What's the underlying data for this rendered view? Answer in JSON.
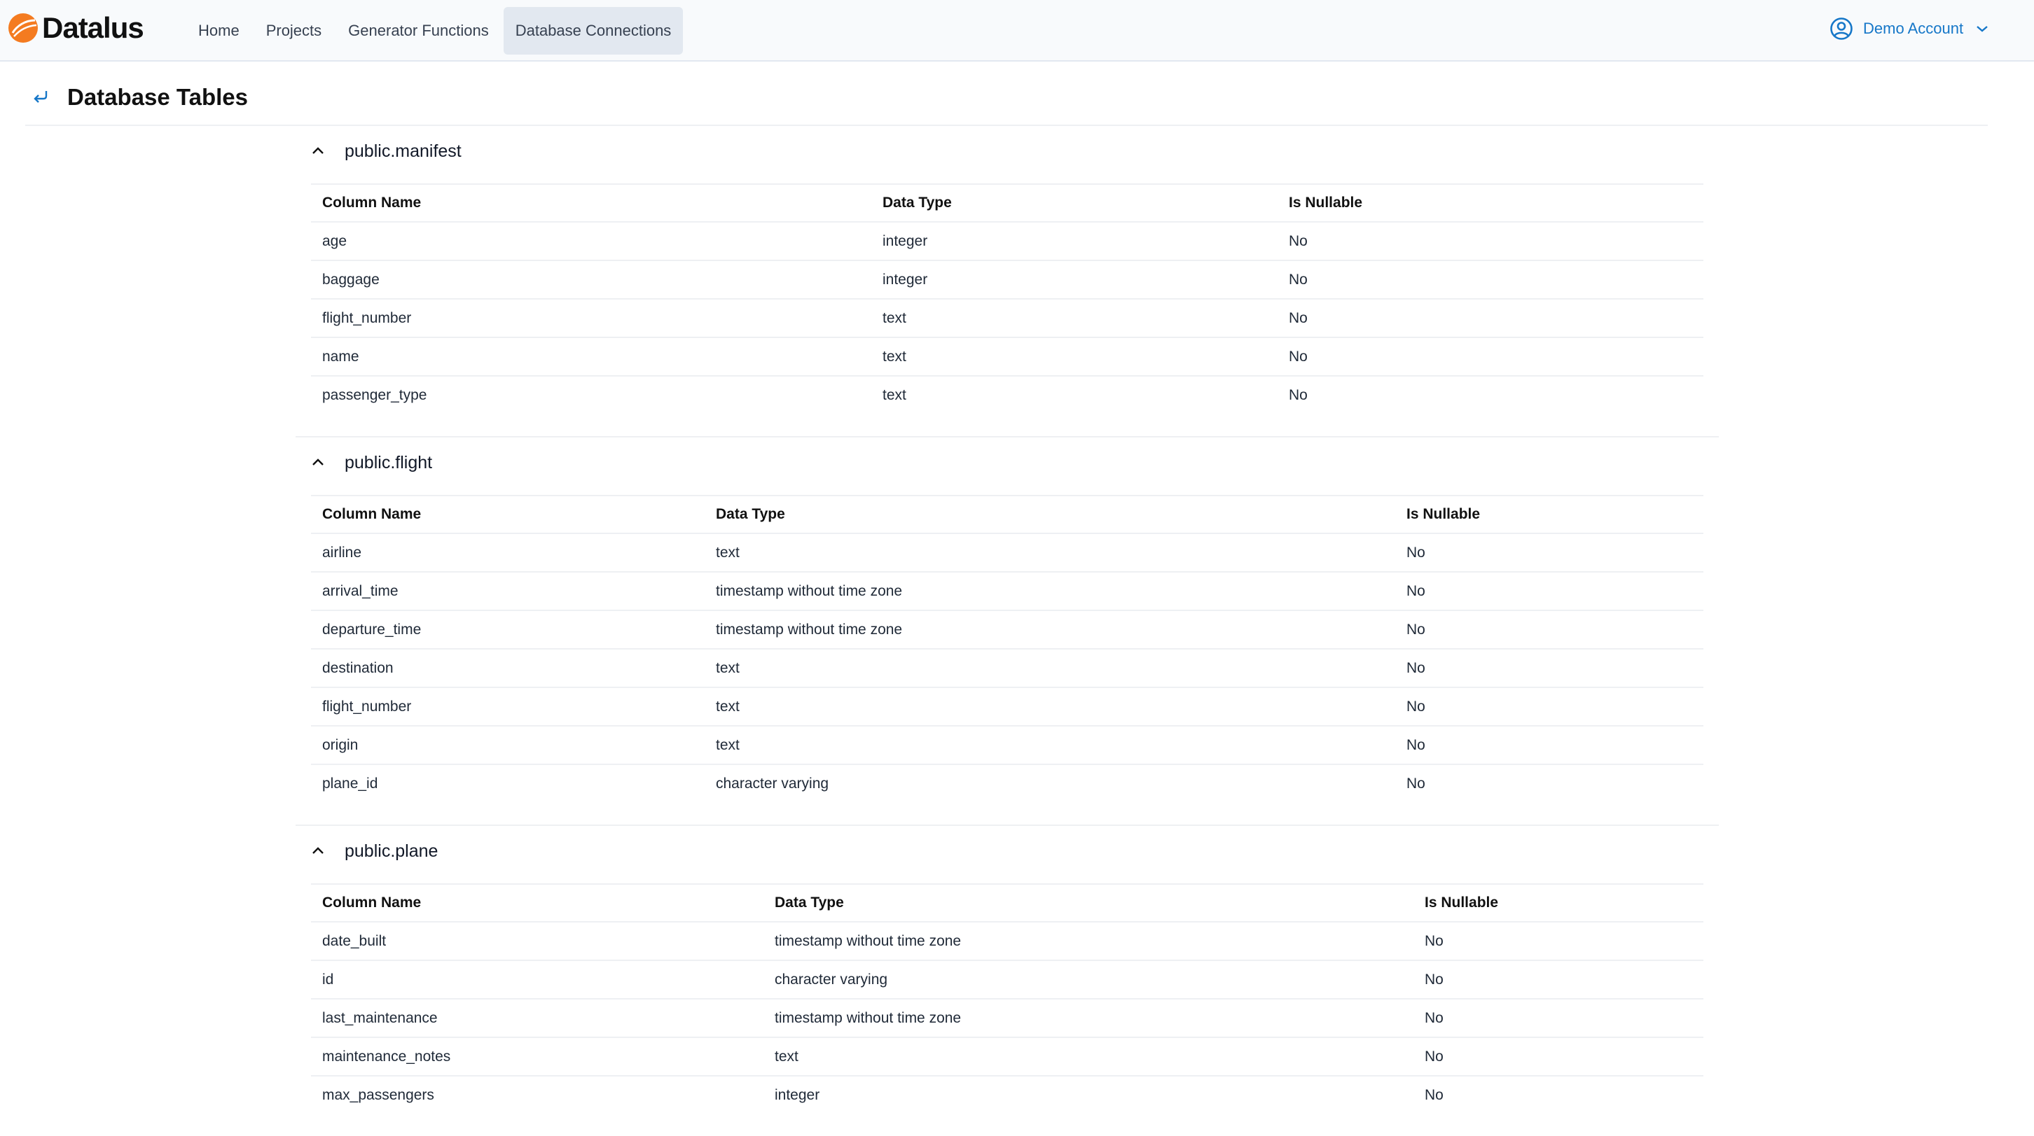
{
  "app": {
    "name": "Datalus",
    "logo_icon": "datalus-logo-icon",
    "accent": "#f47b20"
  },
  "nav": {
    "items": [
      {
        "label": "Home",
        "active": false
      },
      {
        "label": "Projects",
        "active": false
      },
      {
        "label": "Generator Functions",
        "active": false
      },
      {
        "label": "Database Connections",
        "active": true
      }
    ]
  },
  "account": {
    "label": "Demo Account",
    "icon": "user-circle-icon",
    "color": "#1677c8"
  },
  "page": {
    "title": "Database Tables",
    "back_icon": "back-arrow-icon"
  },
  "tables": [
    {
      "name": "public.manifest",
      "expanded": true,
      "headers": [
        "Column Name",
        "Data Type",
        "Is Nullable"
      ],
      "rows": [
        [
          "age",
          "integer",
          "No"
        ],
        [
          "baggage",
          "integer",
          "No"
        ],
        [
          "flight_number",
          "text",
          "No"
        ],
        [
          "name",
          "text",
          "No"
        ],
        [
          "passenger_type",
          "text",
          "No"
        ]
      ]
    },
    {
      "name": "public.flight",
      "expanded": true,
      "headers": [
        "Column Name",
        "Data Type",
        "Is Nullable"
      ],
      "rows": [
        [
          "airline",
          "text",
          "No"
        ],
        [
          "arrival_time",
          "timestamp without time zone",
          "No"
        ],
        [
          "departure_time",
          "timestamp without time zone",
          "No"
        ],
        [
          "destination",
          "text",
          "No"
        ],
        [
          "flight_number",
          "text",
          "No"
        ],
        [
          "origin",
          "text",
          "No"
        ],
        [
          "plane_id",
          "character varying",
          "No"
        ]
      ]
    },
    {
      "name": "public.plane",
      "expanded": true,
      "headers": [
        "Column Name",
        "Data Type",
        "Is Nullable"
      ],
      "rows": [
        [
          "date_built",
          "timestamp without time zone",
          "No"
        ],
        [
          "id",
          "character varying",
          "No"
        ],
        [
          "last_maintenance",
          "timestamp without time zone",
          "No"
        ],
        [
          "maintenance_notes",
          "text",
          "No"
        ],
        [
          "max_passengers",
          "integer",
          "No"
        ]
      ]
    }
  ]
}
